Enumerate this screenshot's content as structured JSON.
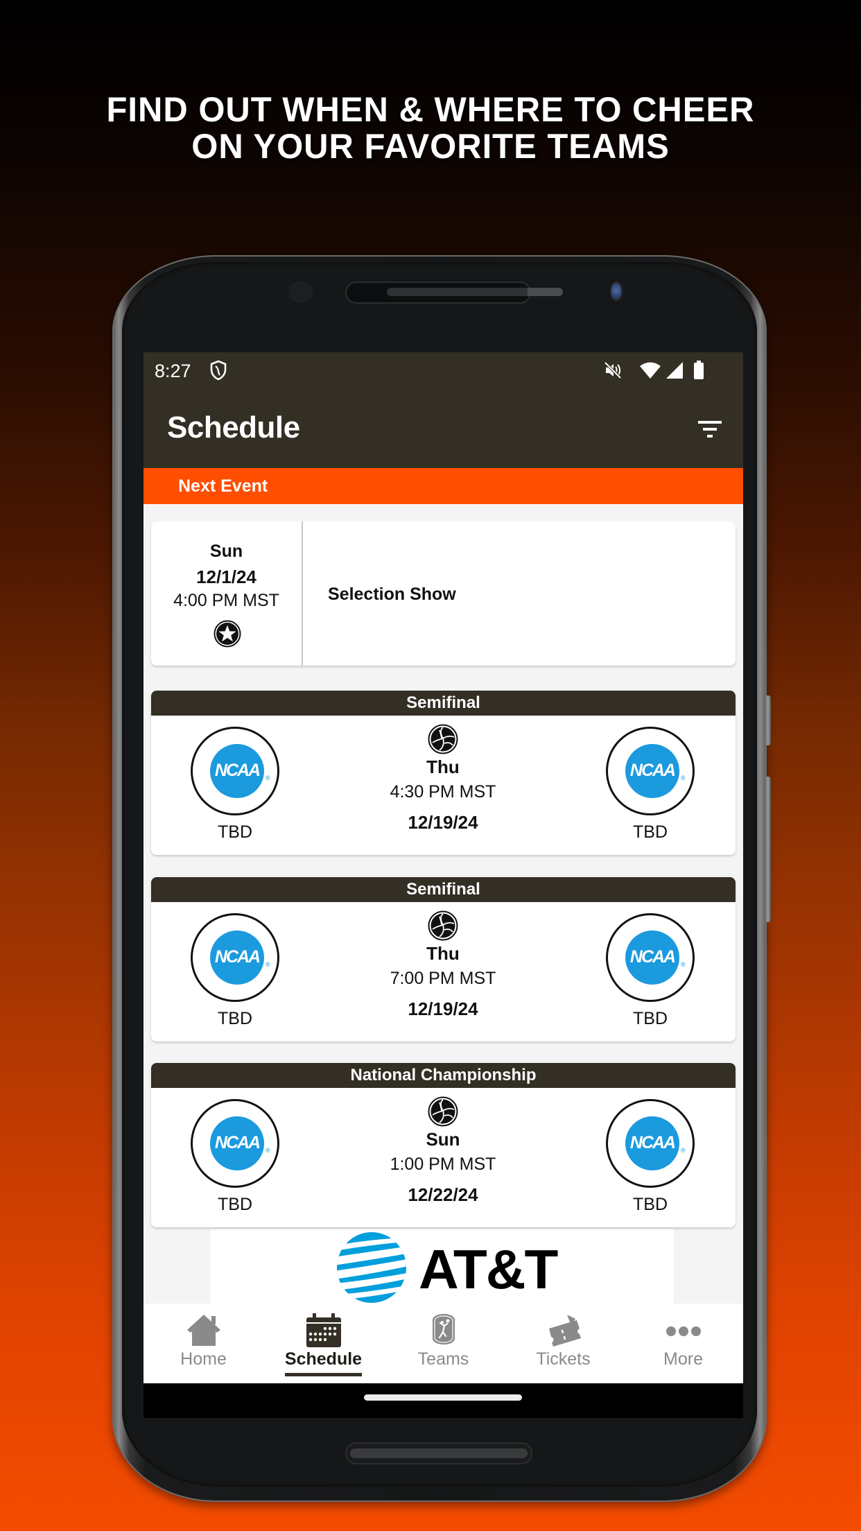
{
  "headline": {
    "line1": "FIND OUT WHEN & WHERE TO CHEER",
    "line2": "ON YOUR FAVORITE TEAMS"
  },
  "colors": {
    "app_bar": "#332F24",
    "accent_orange": "#FF4E00",
    "ncaa_blue": "#1B9ADE",
    "att_blue": "#009FDB",
    "inactive_nav": "#8A8A8A"
  },
  "status_bar": {
    "time": "8:27",
    "left_icons": [
      "shield-icon"
    ],
    "right_icons": [
      "mute-icon",
      "wifi-icon",
      "cell-signal-icon",
      "battery-icon"
    ]
  },
  "app_bar": {
    "title": "Schedule",
    "action_icon": "filter-icon"
  },
  "next_event": {
    "section_label": "Next Event",
    "day": "Sun",
    "date": "12/1/24",
    "time": "4:00 PM MST",
    "icon": "star-badge-icon",
    "title": "Selection Show"
  },
  "games": [
    {
      "round": "Semifinal",
      "sport_icon": "volleyball-icon",
      "day": "Thu",
      "time": "4:30 PM MST",
      "date": "12/19/24",
      "home": {
        "name": "TBD",
        "logo_text": "NCAA"
      },
      "away": {
        "name": "TBD",
        "logo_text": "NCAA"
      }
    },
    {
      "round": "Semifinal",
      "sport_icon": "volleyball-icon",
      "day": "Thu",
      "time": "7:00 PM MST",
      "date": "12/19/24",
      "home": {
        "name": "TBD",
        "logo_text": "NCAA"
      },
      "away": {
        "name": "TBD",
        "logo_text": "NCAA"
      }
    },
    {
      "round": "National Championship",
      "sport_icon": "volleyball-icon",
      "day": "Sun",
      "time": "1:00 PM MST",
      "date": "12/22/24",
      "home": {
        "name": "TBD",
        "logo_text": "NCAA"
      },
      "away": {
        "name": "TBD",
        "logo_text": "NCAA"
      }
    }
  ],
  "logo_registered_mark": "®",
  "sponsor": {
    "name": "AT&T"
  },
  "bottom_nav": {
    "items": [
      {
        "label": "Home",
        "icon": "home-icon",
        "active": false
      },
      {
        "label": "Schedule",
        "icon": "calendar-icon",
        "active": true
      },
      {
        "label": "Teams",
        "icon": "team-badge-icon",
        "active": false
      },
      {
        "label": "Tickets",
        "icon": "ticket-icon",
        "active": false
      },
      {
        "label": "More",
        "icon": "more-dots-icon",
        "active": false
      }
    ]
  }
}
